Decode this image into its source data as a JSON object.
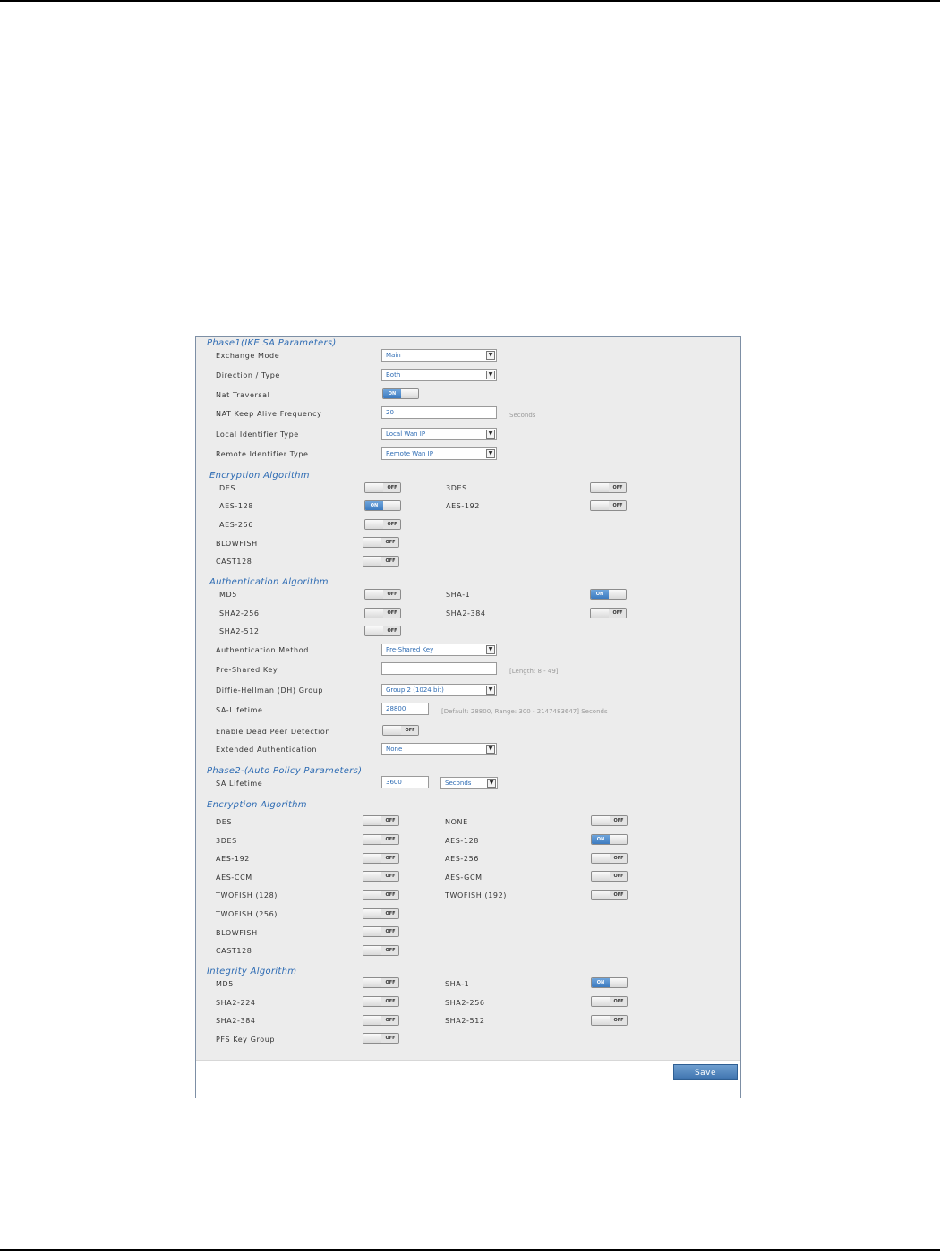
{
  "phase1": {
    "title": "Phase1(IKE SA Parameters)",
    "exchange_mode_label": "Exchange Mode",
    "exchange_mode_value": "Main",
    "direction_label": "Direction / Type",
    "direction_value": "Both",
    "nat_traversal_label": "Nat Traversal",
    "nat_keep_alive_label": "NAT Keep Alive Frequency",
    "nat_keep_alive_value": "20",
    "nat_keep_alive_unit": "Seconds",
    "local_id_label": "Local Identifier Type",
    "local_id_value": "Local Wan IP",
    "remote_id_label": "Remote Identifier Type",
    "remote_id_value": "Remote Wan IP"
  },
  "enc1": {
    "title": "Encryption Algorithm",
    "des": "DES",
    "des3": "3DES",
    "aes128": "AES-128",
    "aes192": "AES-192",
    "aes256": "AES-256",
    "blowfish": "BLOWFISH",
    "cast128": "CAST128"
  },
  "auth1": {
    "title": "Authentication Algorithm",
    "md5": "MD5",
    "sha1": "SHA-1",
    "sha2_256": "SHA2-256",
    "sha2_384": "SHA2-384",
    "sha2_512": "SHA2-512",
    "method_label": "Authentication Method",
    "method_value": "Pre-Shared Key",
    "psk_label": "Pre-Shared Key",
    "psk_value": "",
    "psk_note": "[Length: 8 - 49]",
    "dh_label": "Diffie-Hellman (DH) Group",
    "dh_value": "Group 2 (1024 bit)",
    "sa_lifetime_label": "SA-Lifetime",
    "sa_lifetime_value": "28800",
    "sa_lifetime_note": "[Default: 28800, Range: 300 - 2147483647] Seconds",
    "dpd_label": "Enable Dead Peer Detection",
    "xauth_label": "Extended Authentication",
    "xauth_value": "None"
  },
  "phase2": {
    "title": "Phase2-(Auto Policy Parameters)",
    "sa_lifetime_label": "SA Lifetime",
    "sa_lifetime_value": "3600",
    "sa_lifetime_unit": "Seconds"
  },
  "enc2": {
    "title": "Encryption Algorithm",
    "des": "DES",
    "none": "NONE",
    "des3": "3DES",
    "aes128": "AES-128",
    "aes192": "AES-192",
    "aes256": "AES-256",
    "aesccm": "AES-CCM",
    "aesgcm": "AES-GCM",
    "twofish128": "TWOFISH (128)",
    "twofish192": "TWOFISH (192)",
    "twofish256": "TWOFISH (256)",
    "blowfish": "BLOWFISH",
    "cast128": "CAST128"
  },
  "integ": {
    "title": "Integrity Algorithm",
    "md5": "MD5",
    "sha1": "SHA-1",
    "sha2_224": "SHA2-224",
    "sha2_256": "SHA2-256",
    "sha2_384": "SHA2-384",
    "sha2_512": "SHA2-512",
    "pfs": "PFS Key Group"
  },
  "toggle": {
    "on": "ON",
    "off": "OFF"
  },
  "dropdown_arrow": "▼",
  "save_label": "Save"
}
